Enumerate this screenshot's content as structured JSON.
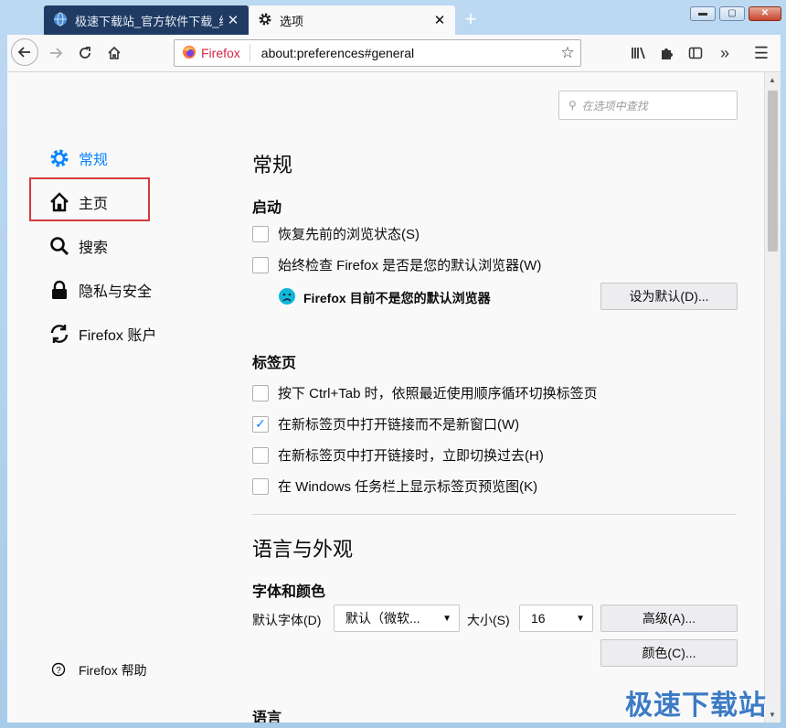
{
  "tabs": [
    {
      "title": "极速下载站_官方软件下载_绿色"
    },
    {
      "title": "选项"
    }
  ],
  "window": {
    "minimize": "▬",
    "maximize": "▢",
    "close": "✕"
  },
  "url": {
    "badge": "Firefox",
    "address": "about:preferences#general"
  },
  "search_placeholder": "在选项中查找",
  "sidebar": {
    "items": [
      {
        "label": "常规"
      },
      {
        "label": "主页"
      },
      {
        "label": "搜索"
      },
      {
        "label": "隐私与安全"
      },
      {
        "label": "Firefox 账户"
      }
    ],
    "help": "Firefox 帮助"
  },
  "main": {
    "title": "常规",
    "startup": {
      "heading": "启动",
      "restore": "恢复先前的浏览状态(S)",
      "check_default": "始终检查 Firefox 是否是您的默认浏览器(W)",
      "not_default": "Firefox 目前不是您的默认浏览器",
      "set_default": "设为默认(D)..."
    },
    "tabs": {
      "heading": "标签页",
      "items": [
        {
          "label": "按下 Ctrl+Tab 时，依照最近使用顺序循环切换标签页",
          "checked": false
        },
        {
          "label": "在新标签页中打开链接而不是新窗口(W)",
          "checked": true
        },
        {
          "label": "在新标签页中打开链接时，立即切换过去(H)",
          "checked": false
        },
        {
          "label": "在 Windows 任务栏上显示标签页预览图(K)",
          "checked": false
        }
      ]
    },
    "lang": {
      "title": "语言与外观",
      "fonts_heading": "字体和颜色",
      "default_font_label": "默认字体(D)",
      "default_font_value": "默认（微软...",
      "size_label": "大小(S)",
      "size_value": "16",
      "advanced": "高级(A)...",
      "colors": "颜色(C)...",
      "language_heading": "语言"
    }
  },
  "watermark": "极速下载站"
}
